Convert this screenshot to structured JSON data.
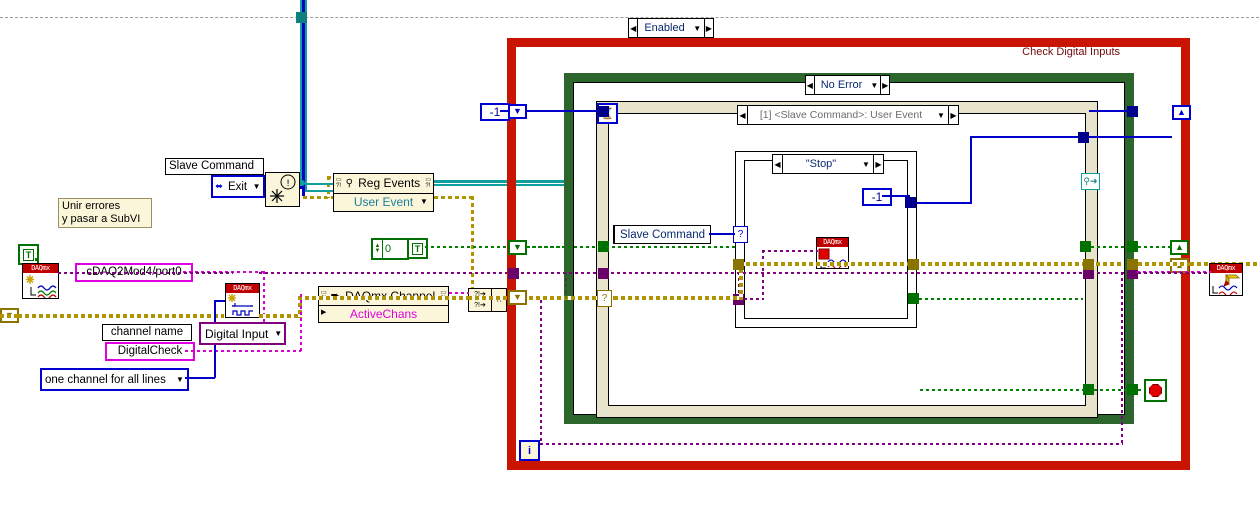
{
  "diagram": {
    "title": "Check Digital Inputs",
    "disable_structure_label": "Enabled",
    "error_case_label": "No Error",
    "event_case_label": "[1] <Slave Command>: User Event",
    "inner_case_label": "\"Stop\""
  },
  "comments": [
    {
      "id": "unir-errores",
      "text": "Unir errores\ny pasar a SubVI"
    }
  ],
  "labels": {
    "slave_command_label": "Slave Command",
    "slave_command_local": "Slave Command",
    "channel_name": "channel name",
    "digital_check": "DigitalCheck",
    "physical_channel": "cDAQ2Mod4/port0",
    "active_chans": "ActiveChans"
  },
  "controls": {
    "slave_command_enum": {
      "value": "Exit",
      "type": "enum-ring"
    },
    "line_grouping_ring": {
      "value": "one channel for all lines",
      "type": "ring"
    },
    "digital_input_ring": {
      "value": "Digital Input",
      "type": "ring"
    }
  },
  "nodes": {
    "reg_events": {
      "title": "Reg Events",
      "subtitle": "User Event"
    },
    "daqmx_channel": {
      "title": "DAQmx Channel",
      "subtitle": "ActiveChans"
    },
    "daqmx_create_vchan": {
      "name": "daqmx-create-virtual-channel"
    },
    "daqmx_create_channel_di": {
      "name": "daqmx-create-channel-digital-input"
    },
    "daqmx_stop_task": {
      "name": "daqmx-stop-task"
    },
    "daqmx_write": {
      "name": "daqmx-write"
    }
  },
  "constants": {
    "timeout_neg_one_outer": "-1",
    "neg_one_inner": "-1",
    "numeric_zero": "0",
    "bool_true_left": "T",
    "bool_true_mid": "T"
  },
  "colors": {
    "while_loop_border": "#c81400",
    "case_structure_border": "#2d662d",
    "event_structure_border": "#e8e4cc",
    "error_wire": "#b09500",
    "boolean_wire": "#0000c8",
    "event_wire": "#0f9f9f",
    "numeric_wire": "#008000",
    "string_wire": "#d400d4",
    "task_wire": "#800080",
    "daqmx_icon_header": "#c00000"
  }
}
